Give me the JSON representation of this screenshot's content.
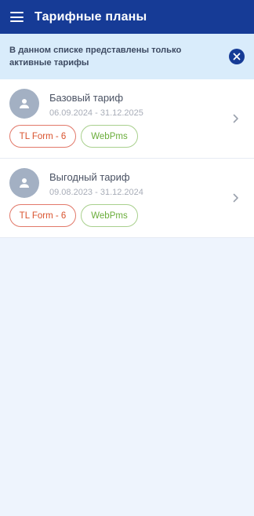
{
  "header": {
    "title": "Тарифные планы",
    "menu_icon": "hamburger-menu-icon"
  },
  "notice": {
    "text": "В данном списке представлены только активные тарифы",
    "close_icon": "close-icon"
  },
  "tariffs": [
    {
      "name": "Базовый тариф",
      "dates": "06.09.2024 - 31.12.2025",
      "tags": [
        "TL Form - 6",
        "WebPms"
      ]
    },
    {
      "name": "Выгодный тариф",
      "dates": "09.08.2023 - 31.12.2024",
      "tags": [
        "TL Form - 6",
        "WebPms"
      ]
    }
  ],
  "colors": {
    "primary": "#163b96",
    "notice_bg": "#d9ecfb",
    "page_bg": "#eef4fd",
    "tag_red": "#d9532e",
    "tag_green": "#6aad3a"
  }
}
